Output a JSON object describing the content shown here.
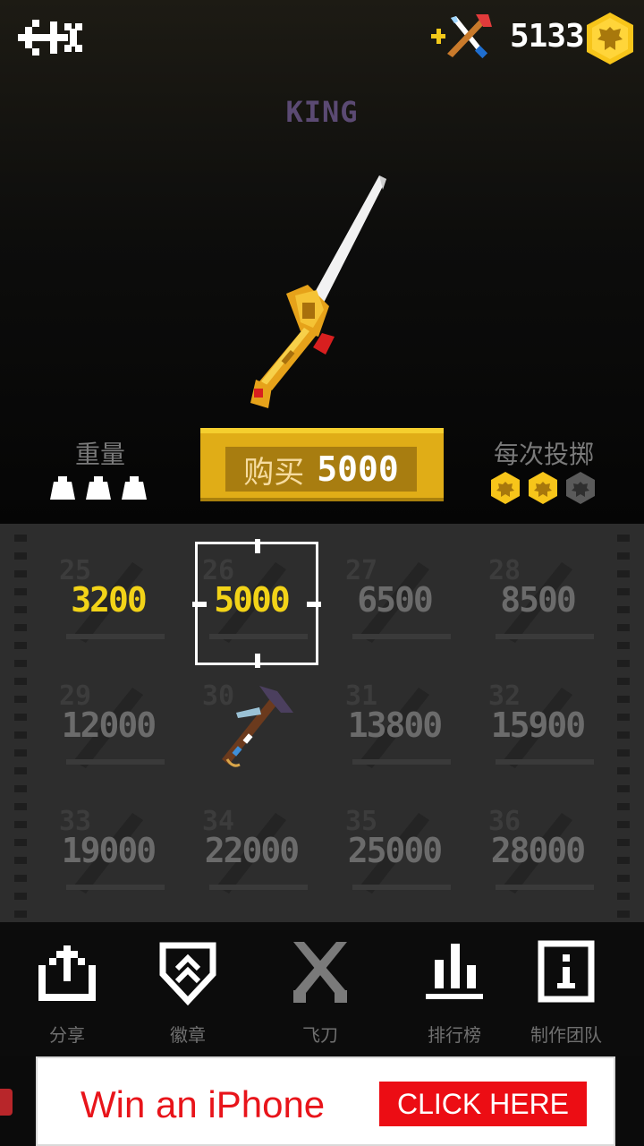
{
  "header": {
    "coins": "5133",
    "icons": [
      "back-arrow-icon",
      "knife-combo-icon",
      "eagle-coin-icon"
    ]
  },
  "item": {
    "name": "KING",
    "weight_label": "重量",
    "weight_level": 3,
    "throw_label": "每次投掷",
    "throw_cost_level": 2,
    "buy_label": "购买",
    "buy_price": "5000"
  },
  "knives": [
    {
      "num": "25",
      "price": "3200",
      "state": "affordable"
    },
    {
      "num": "26",
      "price": "5000",
      "state": "selected"
    },
    {
      "num": "27",
      "price": "6500",
      "state": "locked"
    },
    {
      "num": "28",
      "price": "8500",
      "state": "locked"
    },
    {
      "num": "29",
      "price": "12000",
      "state": "locked"
    },
    {
      "num": "30",
      "price": "",
      "state": "owned"
    },
    {
      "num": "31",
      "price": "13800",
      "state": "locked"
    },
    {
      "num": "32",
      "price": "15900",
      "state": "locked"
    },
    {
      "num": "33",
      "price": "19000",
      "state": "locked"
    },
    {
      "num": "34",
      "price": "22000",
      "state": "locked"
    },
    {
      "num": "35",
      "price": "25000",
      "state": "locked"
    },
    {
      "num": "36",
      "price": "28000",
      "state": "locked"
    }
  ],
  "nav": [
    {
      "label": "分享",
      "icon": "share-icon"
    },
    {
      "label": "徽章",
      "icon": "badge-shield-icon"
    },
    {
      "label": "飞刀",
      "icon": "crossed-knives-icon"
    },
    {
      "label": "排行榜",
      "icon": "leaderboard-icon"
    },
    {
      "label": "制作团队",
      "icon": "info-icon"
    }
  ],
  "ad": {
    "text": "Win an iPhone",
    "button": "CLICK HERE"
  },
  "colors": {
    "gold": "#f2d318",
    "buy_button": "#e0ad17",
    "ad_red": "#ec0d14"
  }
}
